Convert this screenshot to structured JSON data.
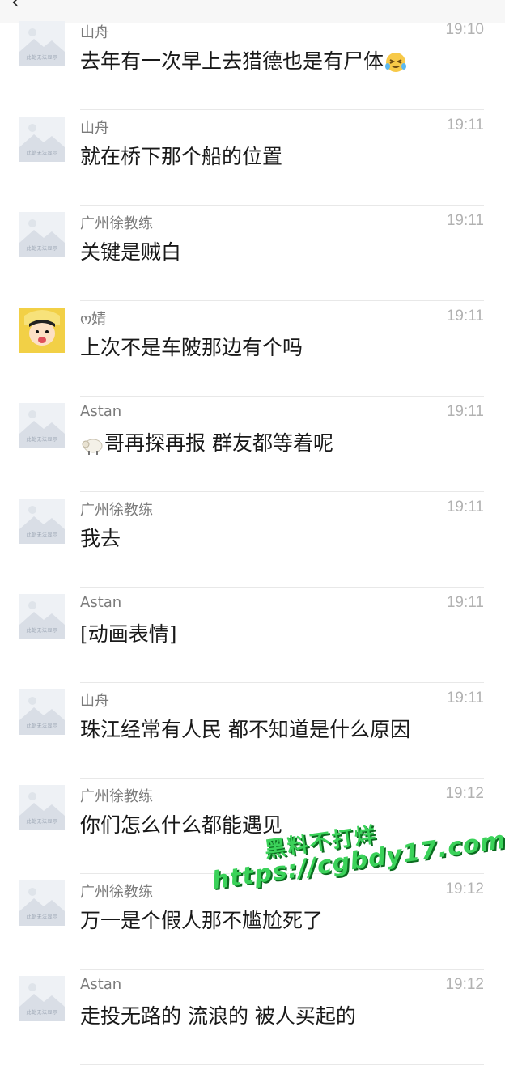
{
  "header": {
    "back_icon": "chevron-left-icon",
    "background": "#f7f7f7"
  },
  "messages": [
    {
      "name": "山舟",
      "time": "19:10",
      "text": "去年有一次早上去猎德也是有尸体",
      "emoji_after": "rolling-laughing-emoji",
      "avatar": "placeholder",
      "avatar_tag": "此处无法显示"
    },
    {
      "name": "山舟",
      "time": "19:11",
      "text": "就在桥下那个船的位置",
      "avatar": "placeholder",
      "avatar_tag": "此处无法显示"
    },
    {
      "name": "广州徐教练",
      "time": "19:11",
      "text": "关键是贼白",
      "avatar": "placeholder",
      "avatar_tag": "此处无法显示"
    },
    {
      "name": "ო婧",
      "time": "19:11",
      "text": "上次不是车陂那边有个吗",
      "avatar": "cartoon-boy"
    },
    {
      "name": "Astan",
      "time": "19:11",
      "text": "哥再探再报 群友都等着呢",
      "emoji_before": "sheep-emoji",
      "avatar": "placeholder",
      "avatar_tag": "此处无法显示"
    },
    {
      "name": "广州徐教练",
      "time": "19:11",
      "text": "我去",
      "avatar": "placeholder",
      "avatar_tag": "此处无法显示"
    },
    {
      "name": "Astan",
      "time": "19:11",
      "text": "[动画表情]",
      "avatar": "placeholder",
      "avatar_tag": "此处无法显示"
    },
    {
      "name": "山舟",
      "time": "19:11",
      "text": "珠江经常有人民 都不知道是什么原因",
      "avatar": "placeholder",
      "avatar_tag": "此处无法显示"
    },
    {
      "name": "广州徐教练",
      "time": "19:12",
      "text": "你们怎么什么都能遇见",
      "avatar": "placeholder",
      "avatar_tag": "此处无法显示"
    },
    {
      "name": "广州徐教练",
      "time": "19:12",
      "text": "万一是个假人那不尴尬死了",
      "avatar": "placeholder",
      "avatar_tag": "此处无法显示"
    },
    {
      "name": "Astan",
      "time": "19:12",
      "text": "走投无路的 流浪的 被人买起的",
      "avatar": "placeholder",
      "avatar_tag": "此处无法显示"
    }
  ],
  "watermark": {
    "line1": "黑料不打烊",
    "line2": "https://cgbdy17.com",
    "color": "#3bd25a"
  },
  "colors": {
    "name": "#7b7b7b",
    "time": "#b2b2b2",
    "text": "#191919",
    "divider": "#e8e8e8"
  }
}
